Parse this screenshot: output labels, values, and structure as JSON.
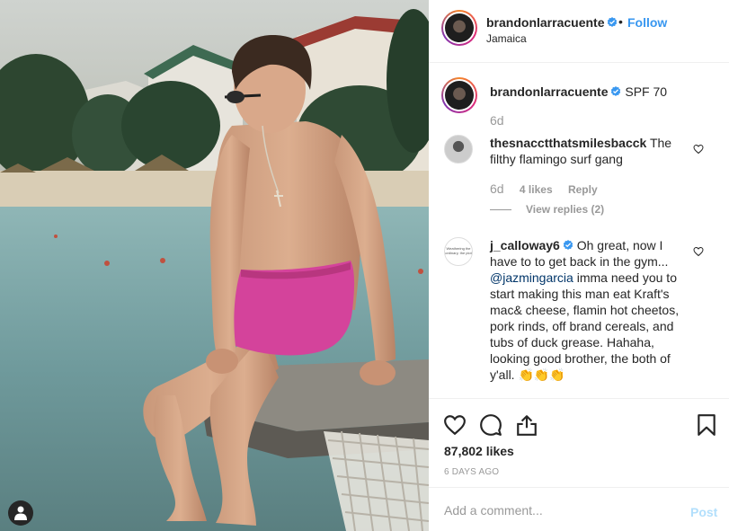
{
  "post": {
    "author": "brandonlarracuente",
    "follow_label": "Follow",
    "dot": "•",
    "location": "Jamaica",
    "caption_text": "SPF 70",
    "caption_age": "6d"
  },
  "comments": [
    {
      "username": "thesnacctthatsmilesbacck",
      "text": "The filthy flamingo surf gang",
      "age": "6d",
      "likes": "4 likes",
      "reply_label": "Reply",
      "view_replies": "View replies (2)"
    },
    {
      "username": "j_calloway6",
      "text_before": "Oh great, now I have to to get back in the gym...",
      "mention": "@jazmingarcia",
      "text_after": "imma need you to start making this man eat Kraft's mac& cheese, flamin hot cheetos, pork rinds, off brand cereals, and tubs of duck grease. Hahaha, looking good brother, the both of y'all. 👏👏👏",
      "avatar_text": "Weathering the ordinary, the plot"
    }
  ],
  "actions": {
    "likes": "87,802 likes",
    "time_ago": "6 DAYS AGO"
  },
  "composer": {
    "placeholder": "Add a comment...",
    "post_label": "Post"
  },
  "icons": {
    "like": "heart-icon",
    "comment": "comment-icon",
    "share": "share-icon",
    "save": "bookmark-icon",
    "user_tag": "user-tag-icon",
    "verified": "verified-badge-icon"
  },
  "colors": {
    "link_blue": "#3897f0",
    "verified_blue": "#3897f0",
    "muted_gray": "#999999",
    "post_disabled": "#b2dffc",
    "text": "#262626",
    "shorts_pink": "#d4439b"
  }
}
